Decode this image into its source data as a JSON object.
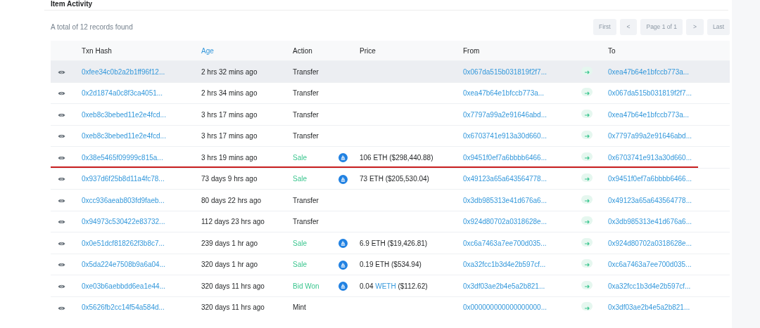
{
  "card": {
    "title": "Item Activity",
    "summary": "A total of 12 records found",
    "pagination": [
      {
        "label": "First",
        "kind": "text"
      },
      {
        "label": "<",
        "kind": "arrow"
      },
      {
        "label": "Page 1 of 1",
        "kind": "text"
      },
      {
        "label": ">",
        "kind": "arrow"
      },
      {
        "label": "Last",
        "kind": "text"
      }
    ]
  },
  "table": {
    "columns": [
      {
        "kind": "icon"
      },
      {
        "label": "Txn Hash",
        "kind": "plain"
      },
      {
        "label": "Age",
        "kind": "link"
      },
      {
        "label": "Action",
        "kind": "plain"
      },
      {
        "kind": "icon"
      },
      {
        "label": "Price",
        "kind": "plain"
      },
      {
        "label": "From",
        "kind": "plain"
      },
      {
        "kind": "icon"
      },
      {
        "label": "To",
        "kind": "plain"
      }
    ],
    "rows": [
      {
        "hash": "0xfee34c0b2a2b1ff96f12...",
        "age": "2 hrs 32 mins ago",
        "action": {
          "label": "Transfer",
          "kind": "plain"
        },
        "from": "0x067da515b031819f2f7...",
        "to": "0xea47b64e1bfccb773a...",
        "highlighted": true,
        "underlined": false
      },
      {
        "hash": "0x2d1874a0c8f3ca4051...",
        "age": "2 hrs 34 mins ago",
        "action": {
          "label": "Transfer",
          "kind": "plain"
        },
        "from": "0xea47b64e1bfccb773a...",
        "to": "0x067da515b031819f2f7...",
        "highlighted": false,
        "underlined": false
      },
      {
        "hash": "0xeb8c3bebed11e2e4fcd...",
        "age": "3 hrs 17 mins ago",
        "action": {
          "label": "Transfer",
          "kind": "plain"
        },
        "from": "0x7797a99a2e91646abd...",
        "to": "0xea47b64e1bfccb773a...",
        "highlighted": false,
        "underlined": false
      },
      {
        "hash": "0xeb8c3bebed11e2e4fcd...",
        "age": "3 hrs 17 mins ago",
        "action": {
          "label": "Transfer",
          "kind": "plain"
        },
        "from": "0x6703741e913a30d660...",
        "to": "0x7797a99a2e91646abd...",
        "highlighted": false,
        "underlined": false
      },
      {
        "hash": "0x38e5465f09999c815a...",
        "age": "3 hrs 19 mins ago",
        "action": {
          "label": "Sale",
          "kind": "trade"
        },
        "price": {
          "text": "106 ETH ($298,440.88)"
        },
        "from": "0x9451f0ef7a6bbbb6466...",
        "to": "0x6703741e913a30d660...",
        "highlighted": false,
        "underlined": true
      },
      {
        "hash": "0x937d6f25b8d11a4fc78...",
        "age": "73 days 9 hrs ago",
        "action": {
          "label": "Sale",
          "kind": "trade"
        },
        "price": {
          "text": "73 ETH ($205,530.04)"
        },
        "from": "0x49123a65a643564778...",
        "to": "0x9451f0ef7a6bbbb6466...",
        "highlighted": false,
        "underlined": false
      },
      {
        "hash": "0xcc936aeab803fd9faeb...",
        "age": "80 days 22 hrs ago",
        "action": {
          "label": "Transfer",
          "kind": "plain"
        },
        "from": "0x3db985313e41d676a6...",
        "to": "0x49123a65a643564778...",
        "highlighted": false,
        "underlined": false
      },
      {
        "hash": "0x94973c530422e83732...",
        "age": "112 days 23 hrs ago",
        "action": {
          "label": "Transfer",
          "kind": "plain"
        },
        "from": "0x924d80702a0318628e...",
        "to": "0x3db985313e41d676a6...",
        "highlighted": false,
        "underlined": false
      },
      {
        "hash": "0x0e51dcf818262f3b8c7...",
        "age": "239 days 1 hr ago",
        "action": {
          "label": "Sale",
          "kind": "trade"
        },
        "price": {
          "text": "6.9 ETH ($19,426.81)"
        },
        "from": "0xc6a7463a7ee700d035...",
        "to": "0x924d80702a0318628e...",
        "highlighted": false,
        "underlined": false
      },
      {
        "hash": "0x5da224e7508b9a6a04...",
        "age": "320 days 1 hr ago",
        "action": {
          "label": "Sale",
          "kind": "trade"
        },
        "price": {
          "text": "0.19 ETH ($534.94)"
        },
        "from": "0xa32fcc1b3d4e2b597cf...",
        "to": "0xc6a7463a7ee700d035...",
        "highlighted": false,
        "underlined": false
      },
      {
        "hash": "0xe03b6aebbdd6ea1e44...",
        "age": "320 days 11 hrs ago",
        "action": {
          "label": "Bid Won",
          "kind": "trade"
        },
        "price": {
          "text": "0.04",
          "link": "WETH",
          "after": "($112.62)"
        },
        "from": "0x3df03ae2b4e5a2b821...",
        "to": "0xa32fcc1b3d4e2b597cf...",
        "highlighted": false,
        "underlined": false
      },
      {
        "hash": "0x5626fb2cc14f54a584d...",
        "age": "320 days 11 hrs ago",
        "action": {
          "label": "Mint",
          "kind": "plain"
        },
        "from": "0x000000000000000000...",
        "to": "0x3df03ae2b4e5a2b821...",
        "highlighted": false,
        "underlined": false
      }
    ]
  }
}
